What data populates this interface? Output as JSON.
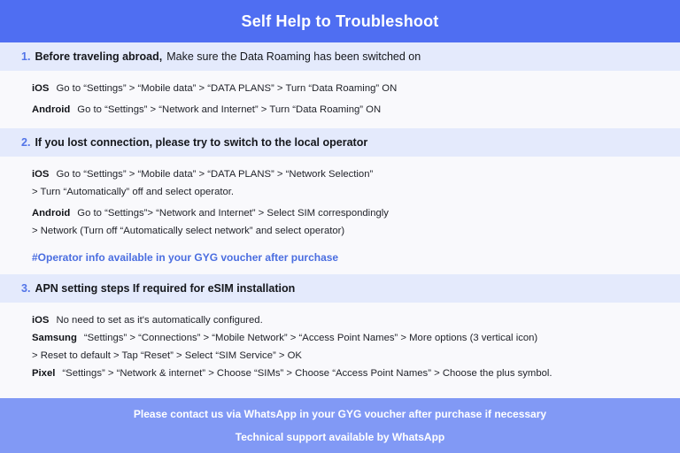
{
  "header": {
    "title": "Self Help to Troubleshoot",
    "bg_color": "#4f6ef2",
    "text_color": "#ffffff"
  },
  "theme": {
    "band_bg": "#e4eafc",
    "body_bg": "#f9f9fc",
    "accent": "#5274e8",
    "note_color": "#4b6ee0",
    "footer_bg": "#8199f5"
  },
  "sections": [
    {
      "number": "1.",
      "heading_strong": "Before traveling abroad,",
      "heading_rest": "Make sure the Data Roaming has been switched on",
      "lines": [
        {
          "platform": "iOS",
          "text": "Go to “Settings” > “Mobile data” > “DATA PLANS” > Turn “Data Roaming” ON"
        },
        {
          "platform": "Android",
          "text": "Go to “Settings” > “Network and Internet” > Turn “Data Roaming” ON"
        }
      ],
      "note": ""
    },
    {
      "number": "2.",
      "heading_strong": "If you lost connection, please try to switch to the local operator",
      "heading_rest": "",
      "lines": [
        {
          "platform": "iOS",
          "text": "Go to “Settings” > “Mobile data” > “DATA PLANS” > “Network Selection”"
        },
        {
          "platform": "",
          "text": "> Turn “Automatically” off and select operator."
        },
        {
          "platform": "Android",
          "text": "Go to “Settings”>  “Network and Internet” > Select SIM correspondingly"
        },
        {
          "platform": "",
          "text": "> Network (Turn off “Automatically select network” and select operator)"
        }
      ],
      "note": "#Operator info available in your GYG voucher after purchase"
    },
    {
      "number": "3.",
      "heading_strong": "APN setting steps If required for eSIM installation",
      "heading_rest": "",
      "lines": [
        {
          "platform": "iOS",
          "text": "No need to set as it's automatically configured."
        },
        {
          "platform": "Samsung",
          "text": "“Settings” > “Connections” > “Mobile Network” > “Access Point Names” > More options (3 vertical icon)"
        },
        {
          "platform": "",
          "text": "> Reset to default > Tap “Reset” > Select “SIM Service” > OK"
        },
        {
          "platform": "Pixel",
          "text": "“Settings” > “Network & internet” > Choose “SIMs” > Choose “Access Point Names” > Choose the plus symbol."
        }
      ],
      "note": ""
    }
  ],
  "footer": {
    "line1": "Please contact us via WhatsApp  in your GYG voucher after purchase if necessary",
    "line2": "Technical support available by WhatsApp"
  }
}
